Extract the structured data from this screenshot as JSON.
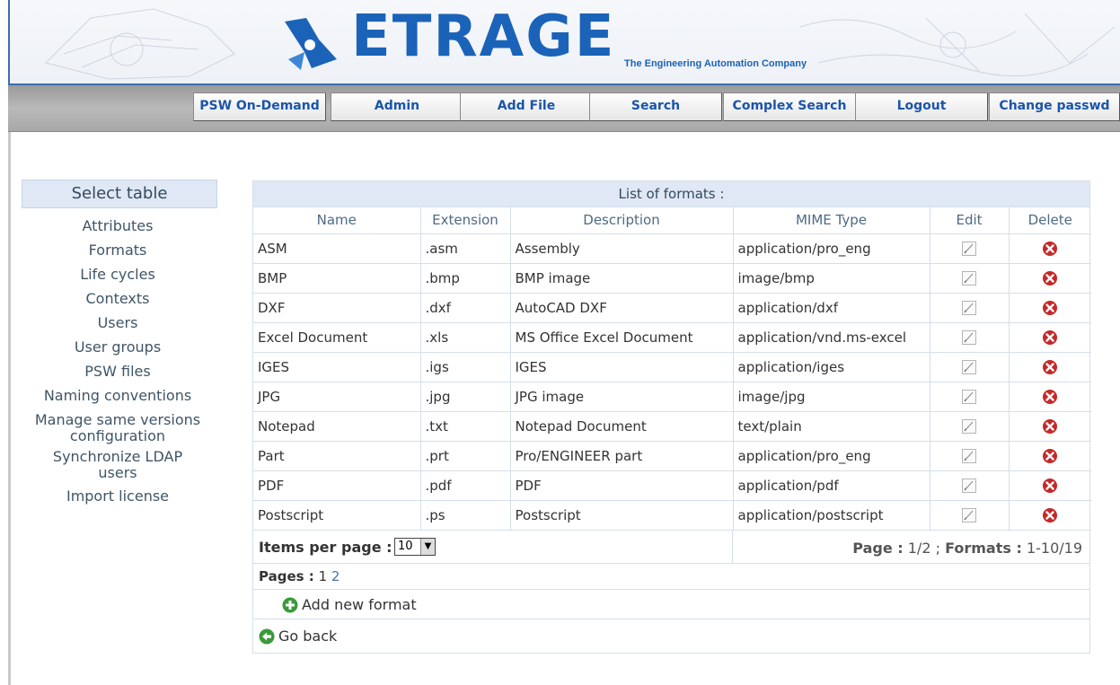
{
  "brand": {
    "name": "ETRAGE",
    "tagline": "The Engineering Automation Company"
  },
  "nav": [
    {
      "label": "PSW On-Demand"
    },
    {
      "label": "Admin"
    },
    {
      "label": "Add File"
    },
    {
      "label": "Search"
    },
    {
      "label": "Complex Search"
    },
    {
      "label": "Logout"
    },
    {
      "label": "Change passwd"
    }
  ],
  "sidebar": {
    "title": "Select table",
    "items": [
      "Attributes",
      "Formats",
      "Life cycles",
      "Contexts",
      "Users",
      "User groups",
      "PSW files",
      "Naming conventions",
      "Manage same versions configuration",
      "Synchronize LDAP users",
      "Import license"
    ]
  },
  "table": {
    "title": "List of formats :",
    "columns": [
      "Name",
      "Extension",
      "Description",
      "MIME Type",
      "Edit",
      "Delete"
    ],
    "rows": [
      [
        "ASM",
        ".asm",
        "Assembly",
        "application/pro_eng"
      ],
      [
        "BMP",
        ".bmp",
        "BMP image",
        "image/bmp"
      ],
      [
        "DXF",
        ".dxf",
        "AutoCAD DXF",
        "application/dxf"
      ],
      [
        "Excel Document",
        ".xls",
        "MS Office Excel Document",
        "application/vnd.ms-excel"
      ],
      [
        "IGES",
        ".igs",
        "IGES",
        "application/iges"
      ],
      [
        "JPG",
        ".jpg",
        "JPG image",
        "image/jpg"
      ],
      [
        "Notepad",
        ".txt",
        "Notepad Document",
        "text/plain"
      ],
      [
        "Part",
        ".prt",
        "Pro/ENGINEER part",
        "application/pro_eng"
      ],
      [
        "PDF",
        ".pdf",
        "PDF",
        "application/pdf"
      ],
      [
        "Postscript",
        ".ps",
        "Postscript",
        "application/postscript"
      ]
    ],
    "icons": {
      "edit": "edit-pencil-icon",
      "delete": "delete-x-icon"
    }
  },
  "footer": {
    "items_label": "Items per page :",
    "items_value": "10",
    "page_label": "Page :",
    "page_value": "1/2",
    "formats_label": "Formats :",
    "formats_value": "1-10/19",
    "pages_label": "Pages :",
    "pages": [
      "1",
      "2"
    ],
    "add_label": "Add new format",
    "back_label": "Go back"
  },
  "colors": {
    "brand": "#1b63b8",
    "delete_red": "#c62828",
    "add_green": "#3a9a3a",
    "header_bg": "#dfe8f4"
  }
}
